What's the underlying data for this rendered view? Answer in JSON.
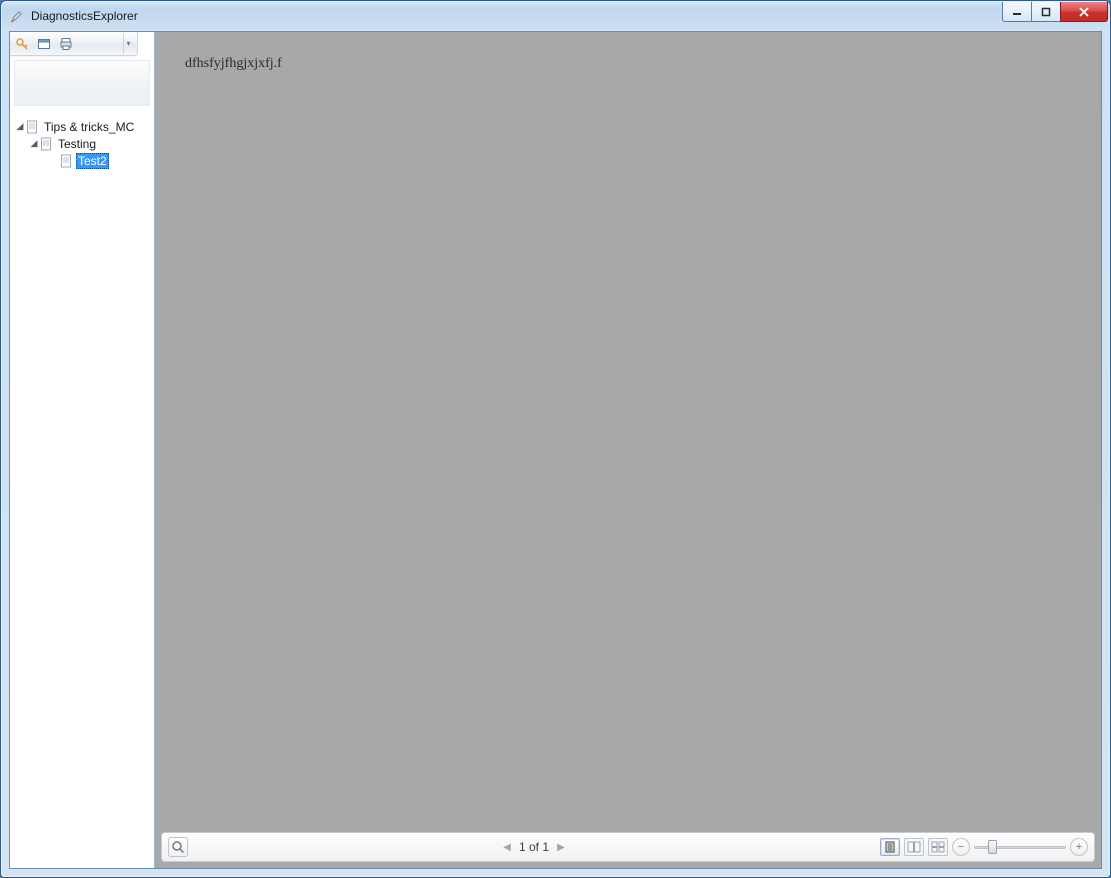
{
  "window": {
    "title": "DiagnosticsExplorer"
  },
  "toolbar": {
    "icons": [
      "key-icon",
      "window-icon",
      "print-icon"
    ]
  },
  "tree": {
    "nodes": [
      {
        "label": "Tips & tricks_MC",
        "level": 1,
        "expanded": true,
        "selected": false
      },
      {
        "label": "Testing",
        "level": 2,
        "expanded": true,
        "selected": false
      },
      {
        "label": "Test2",
        "level": 3,
        "expanded": false,
        "selected": true
      }
    ]
  },
  "content": {
    "body_text": "dfhsfyjfhgjxjxfj.f"
  },
  "footer": {
    "page_label": "1 of 1",
    "zoom_percent": 15
  }
}
